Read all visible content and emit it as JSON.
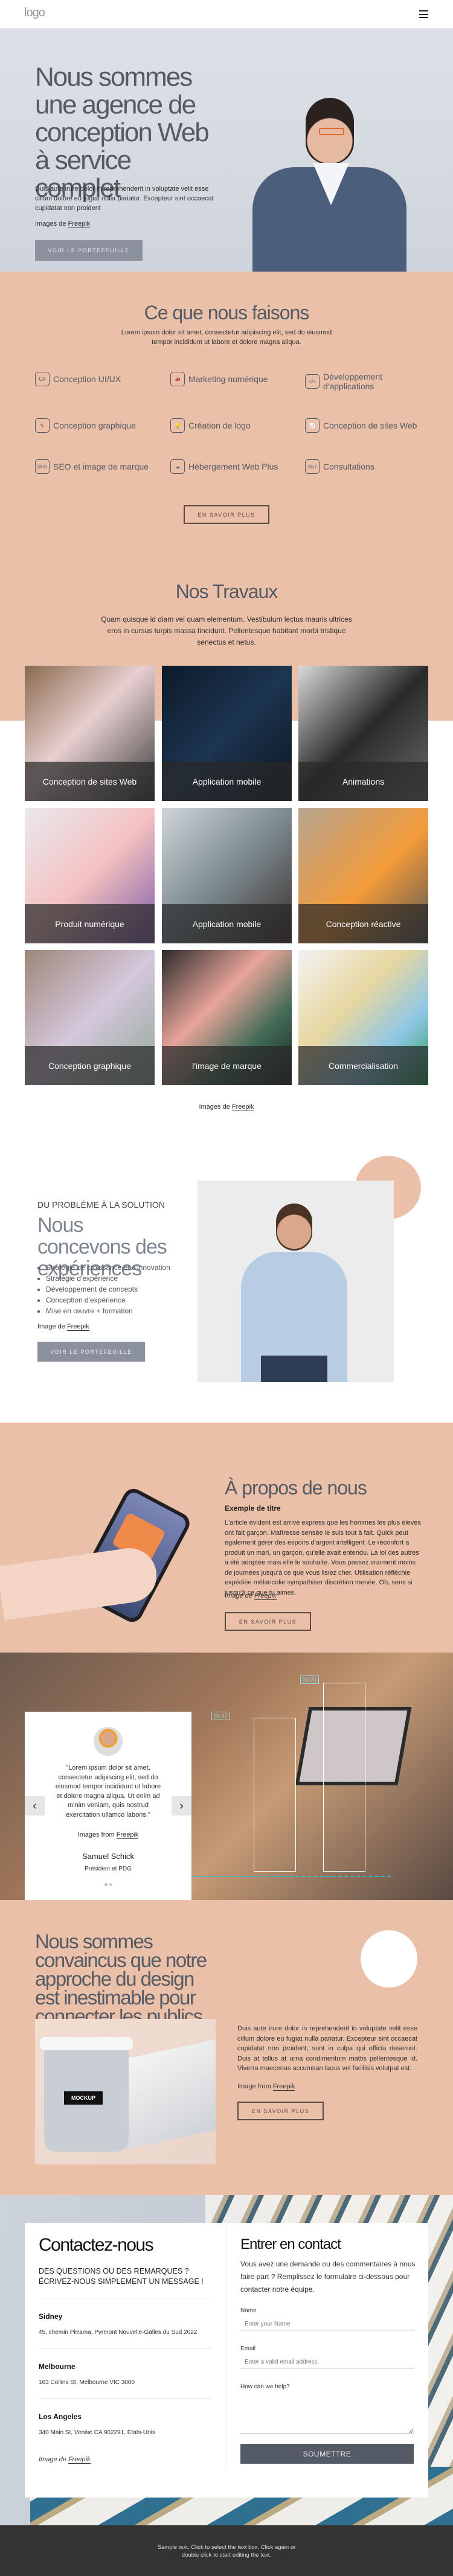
{
  "header": {
    "logo": "logo",
    "menu_icon": "hamburger-icon"
  },
  "hero": {
    "title": "Nous sommes une agence de conception Web à service complet",
    "text": "Duis aute irure dolor in reprehenderit in voluptate velit esse cillum dolore eu fugiat nulla pariatur. Excepteur sint occaecat cupidatat non proident",
    "credit_prefix": "Images de",
    "credit_link": "Freepik",
    "button": "VOIR LE PORTEFEUILLE"
  },
  "services": {
    "title": "Ce que nous faisons",
    "text": "Lorem ipsum dolor sit amet, consectetur adipiscing elit, sed do eiusmod tempor incididunt ut labore et dolore magna aliqua.",
    "items": [
      {
        "label": "Conception UI/UX",
        "icon": "ux-icon"
      },
      {
        "label": "Marketing numérique",
        "icon": "megaphone-icon"
      },
      {
        "label": "Développement d'applications",
        "icon": "mobile-code-icon"
      },
      {
        "label": "Conception graphique",
        "icon": "document-pen-icon"
      },
      {
        "label": "Création de logo",
        "icon": "lightbulb-icon"
      },
      {
        "label": "Conception de sites Web",
        "icon": "monitor-chart-icon"
      },
      {
        "label": "SEO et image de marque",
        "icon": "seo-magnifier-icon"
      },
      {
        "label": "Hébergement Web Plus",
        "icon": "cloud-network-icon"
      },
      {
        "label": "Consultations",
        "icon": "24-7-icon"
      }
    ],
    "button": "EN SAVOIR PLUS"
  },
  "works": {
    "title": "Nos Travaux",
    "text": "Quam quisque id diam vel quam elementum. Vestibulum lectus mauris ultrices eros in cursus turpis massa tincidunt. Pellentesque habitant morbi tristique senectus et netus.",
    "items": [
      "Conception de sites Web",
      "Application mobile",
      "Animations",
      "Produit numérique",
      "Application mobile",
      "Conception réactive",
      "Conception graphique",
      "l'image de marque",
      "Commercialisation"
    ],
    "credit_prefix": "Images de",
    "credit_link": "Freepik"
  },
  "experience": {
    "eyebrow": "DU PROBLÈME À LA SOLUTION",
    "title": "Nous concevons des expériences",
    "bullets": [
      "Stratégie de croissance et d'innovation",
      "Stratégie d'expérience",
      "Développement de concepts",
      "Conception d'expérience",
      "Mise en œuvre + formation"
    ],
    "credit_prefix": "Image de",
    "credit_link": "Freepik",
    "button": "VOIR LE PORTEFEUILLE"
  },
  "about": {
    "title": "À propos de nous",
    "subtitle": "Exemple de titre",
    "text": "L'article évident est arrivé express que les hommes les plus élevés ont fait garçon. Maîtresse sensée le suis tout à fait. Quick peut également gérer des espoirs d'argent intelligent. Le réconfort a produit un mari, un garçon, qu'elle avait entendu. La loi des autres a été adoptée mais elle le souhaite. Vous passez vraiment moins de journées jusqu'à ce que vous lisiez cher. Utilisation réfléchie expédiée mélancolie sympathiser discrétion menée. Oh, sens si jusqu'à ce que tu aimes.",
    "credit_prefix": "Image de",
    "credit_link": "Freepik",
    "button": "EN SAVOIR PLUS"
  },
  "testimonial": {
    "quote": "\"Lorem ipsum dolor sit amet, consectetur adipiscing elit, sed do eiusmod tempor incididunt ut labore et dolore magna aliqua. Ut enim ad minim veniam, quis nostrud exercitation ullamco laboris.\"",
    "credit_prefix": "Images from",
    "credit_link": "Freepik",
    "name": "Samuel Schick",
    "role": "Président et PDG",
    "chart_labels": [
      "00.70",
      "00.47"
    ],
    "slides": 2,
    "active_slide": 1
  },
  "approach": {
    "title": "Nous sommes convaincus que notre approche du design est inestimable pour connecter les publics.",
    "text": "Duis aute irure dolor in reprehenderit in voluptate velit esse cillum dolore eu fugiat nulla pariatur. Excepteur sint occaecat cupidatat non proident, sunt in culpa qui officia deserunt. Duis at tellus at urna condimentum mattis pellentesque id. Viverra maecenas accumsan lacus vel facilisis volutpat est.",
    "credit_prefix": "Image from",
    "credit_link": "Freepik",
    "button": "EN SAVOIR PLUS",
    "mockup_label": "MOCKUP"
  },
  "contact": {
    "title": "Contactez-nous",
    "subtitle": "DES QUESTIONS OU DES REMARQUES ? ÉCRIVEZ-NOUS SIMPLEMENT UN MESSAGE !",
    "offices": [
      {
        "city": "Sidney",
        "address": "45, chemin Pirrama, Pyrmont Nouvelle-Galles du Sud 2022"
      },
      {
        "city": "Melbourne",
        "address": "163 Collins St, Melbourne VIC 3000"
      },
      {
        "city": "Los Angeles",
        "address": "340 Main St, Venise CA 902291, États-Unis"
      }
    ],
    "credit_prefix": "Image de",
    "credit_link": "Freepik",
    "form": {
      "title": "Entrer en contact",
      "text": "Vous avez une demande ou des commentaires à nous faire part ? Remplissez le formulaire ci-dessous pour contacter notre équipe.",
      "name_label": "Name",
      "name_placeholder": "Enter your Name",
      "email_label": "Email",
      "email_placeholder": "Enter a valid email address",
      "message_label": "How can we help?",
      "submit": "SOUMETTRE"
    }
  },
  "footer": {
    "text": "Sample text. Click to select the text box. Click again or double click to start editing the text."
  },
  "colors": {
    "peach": "#ebc0a8",
    "heading": "#555a64",
    "button": "#8a909c",
    "submit": "#545b66",
    "footer": "#333333"
  }
}
